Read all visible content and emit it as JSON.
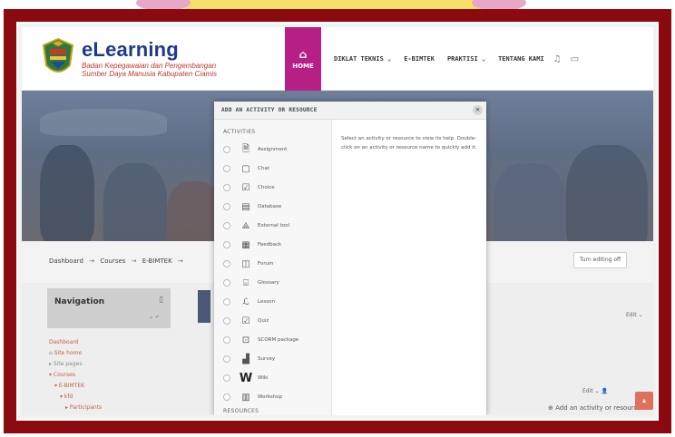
{
  "brand": {
    "title": "eLearning",
    "subtitle_line1": "Badan Kepegawaian dan Pengembangan",
    "subtitle_line2": "Sumber Daya Manusia Kabupaten Ciamis"
  },
  "nav": {
    "home": "HOME",
    "items": [
      "DIKLAT TEKNIS ⌄",
      "E-BIMTEK",
      "PRAKTISI ⌄",
      "TENTANG KAMI"
    ]
  },
  "breadcrumb": {
    "items": [
      "Dashboard",
      "Courses",
      "E-BIMTEK"
    ]
  },
  "turn_editing": "Turn editing off",
  "navigation_block": {
    "title": "Navigation",
    "tree": [
      "Dashboard",
      "Site home",
      "Site pages",
      "Courses",
      "E-BIMTEK",
      "kfd",
      "Participants"
    ]
  },
  "right": {
    "edit1": "Edit ⌄",
    "edit2": "Edit ⌄ 👤",
    "add_activity": "Add an activity or resource"
  },
  "modal": {
    "title": "ADD AN ACTIVITY OR RESOURCE",
    "close": "×",
    "activities_label": "ACTIVITIES",
    "resources_label": "RESOURCES",
    "activities": [
      {
        "label": "Assignment",
        "icon": "assignment-icon"
      },
      {
        "label": "Chat",
        "icon": "chat-icon"
      },
      {
        "label": "Choice",
        "icon": "choice-icon"
      },
      {
        "label": "Database",
        "icon": "database-icon"
      },
      {
        "label": "External tool",
        "icon": "external-tool-icon"
      },
      {
        "label": "Feedback",
        "icon": "feedback-icon"
      },
      {
        "label": "Forum",
        "icon": "forum-icon"
      },
      {
        "label": "Glossary",
        "icon": "glossary-icon"
      },
      {
        "label": "Lesson",
        "icon": "lesson-icon"
      },
      {
        "label": "Quiz",
        "icon": "quiz-icon"
      },
      {
        "label": "SCORM package",
        "icon": "scorm-icon"
      },
      {
        "label": "Survey",
        "icon": "survey-icon"
      },
      {
        "label": "Wiki",
        "icon": "wiki-icon"
      },
      {
        "label": "Workshop",
        "icon": "workshop-icon"
      }
    ],
    "help_text": "Select an activity or resource to view its help. Double-click on an activity or resource name to quickly add it."
  },
  "colors": {
    "frame": "#8b0a0f",
    "home_active": "#b51f86",
    "brand": "#1d3a8a",
    "accent": "#e0705e"
  }
}
